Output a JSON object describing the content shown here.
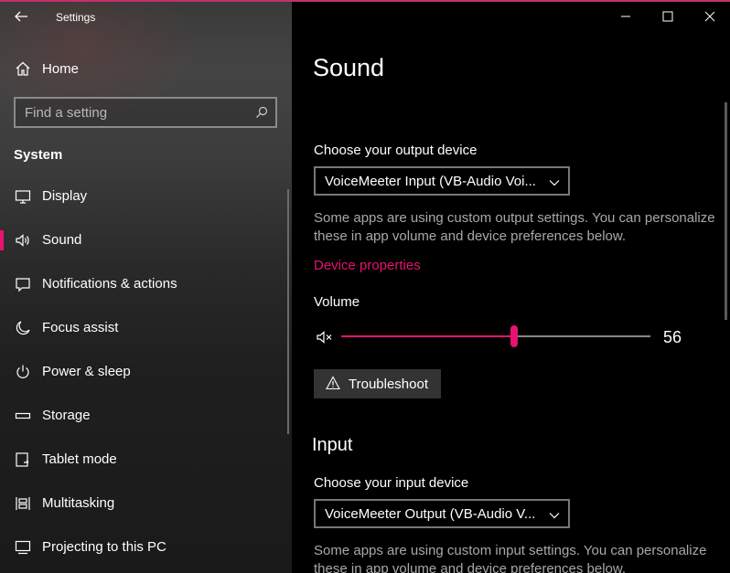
{
  "window": {
    "title": "Settings"
  },
  "sidebar": {
    "home_label": "Home",
    "search_placeholder": "Find a setting",
    "section": "System",
    "items": [
      {
        "label": "Display",
        "icon": "monitor-icon"
      },
      {
        "label": "Sound",
        "icon": "speaker-icon",
        "selected": true
      },
      {
        "label": "Notifications & actions",
        "icon": "notification-icon"
      },
      {
        "label": "Focus assist",
        "icon": "moon-icon"
      },
      {
        "label": "Power & sleep",
        "icon": "power-icon"
      },
      {
        "label": "Storage",
        "icon": "storage-icon"
      },
      {
        "label": "Tablet mode",
        "icon": "tablet-icon"
      },
      {
        "label": "Multitasking",
        "icon": "multitasking-icon"
      },
      {
        "label": "Projecting to this PC",
        "icon": "projector-icon"
      }
    ]
  },
  "main": {
    "title": "Sound",
    "output": {
      "label": "Choose your output device",
      "selected": "VoiceMeeter Input (VB-Audio Voi...",
      "description": "Some apps are using custom output settings. You can personalize these in app volume and device preferences below.",
      "device_properties_link": "Device properties",
      "volume_label": "Volume",
      "volume_value": "56",
      "volume_level_percent": 56,
      "troubleshoot_label": "Troubleshoot"
    },
    "input": {
      "section_title": "Input",
      "label": "Choose your input device",
      "selected": "VoiceMeeter Output (VB-Audio V...",
      "description": "Some apps are using custom input settings. You can personalize these in app volume and device preferences below."
    }
  },
  "colors": {
    "accent": "#e6136f",
    "background": "#000000",
    "secondary_text": "#a8a8a8"
  }
}
